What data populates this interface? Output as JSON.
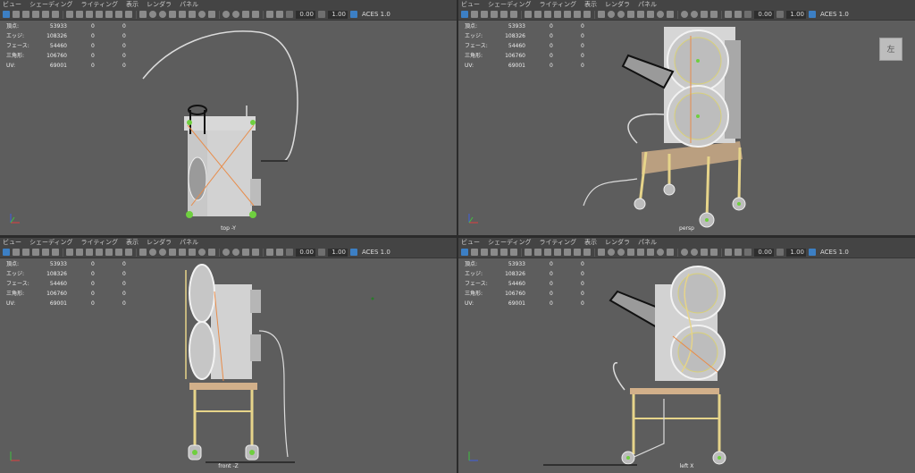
{
  "menu": [
    "ビュー",
    "シェーディング",
    "ライティング",
    "表示",
    "レンダラ",
    "パネル"
  ],
  "toolbar": {
    "field1": "0.00",
    "field2": "1.00",
    "colorspace": "ACES 1.0"
  },
  "hud": {
    "rows": [
      {
        "label": "頂点:",
        "v1": "53933",
        "v2": "0",
        "v3": "0"
      },
      {
        "label": "エッジ:",
        "v1": "108326",
        "v2": "0",
        "v3": "0"
      },
      {
        "label": "フェース:",
        "v1": "54460",
        "v2": "0",
        "v3": "0"
      },
      {
        "label": "三角形:",
        "v1": "106760",
        "v2": "0",
        "v3": "0"
      },
      {
        "label": "UV:",
        "v1": "69001",
        "v2": "0",
        "v3": "0"
      }
    ]
  },
  "panes": {
    "tl": {
      "camera": "top -Y"
    },
    "tr": {
      "camera": "persp",
      "viewcube_label": "左"
    },
    "bl": {
      "camera": "front -Z"
    },
    "br": {
      "camera": "left X"
    }
  },
  "colors": {
    "viewport_bg": "#5d5d5d",
    "toolbar_bg": "#444444",
    "selection_green": "#6fcf3f",
    "wireframe_yellow": "#e6d48a",
    "highlight_orange": "#e88c4a"
  }
}
